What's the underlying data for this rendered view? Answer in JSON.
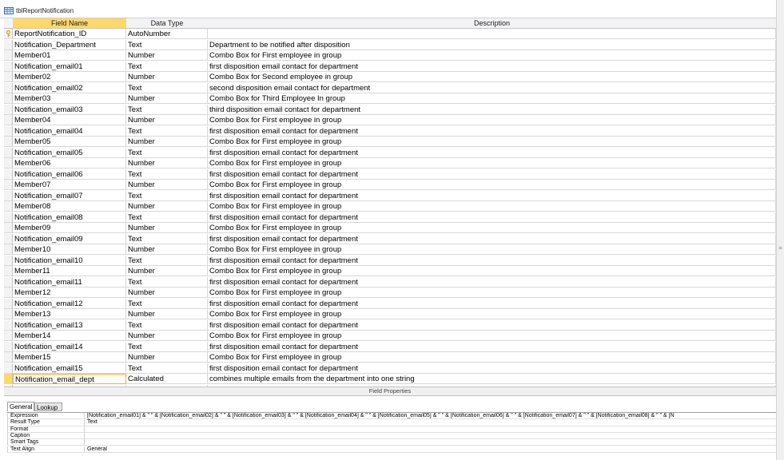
{
  "window": {
    "tab_title": "tblReportNotification"
  },
  "columns": [
    "Field Name",
    "Data Type",
    "Description"
  ],
  "rows": [
    {
      "field": "ReportNotification_ID",
      "type": "AutoNumber",
      "desc": "",
      "primary_key": true
    },
    {
      "field": "Notification_Department",
      "type": "Text",
      "desc": "Department to be notified after disposition"
    },
    {
      "field": "Member01",
      "type": "Number",
      "desc": "Combo Box for First employee in group"
    },
    {
      "field": "Notification_email01",
      "type": "Text",
      "desc": "first disposition email contact for department"
    },
    {
      "field": "Member02",
      "type": "Number",
      "desc": "Combo Box for Second employee in group"
    },
    {
      "field": "Notification_email02",
      "type": "Text",
      "desc": "second disposition email contact for department"
    },
    {
      "field": "Member03",
      "type": "Number",
      "desc": "Combo Box for Third Employee In group"
    },
    {
      "field": "Notification_email03",
      "type": "Text",
      "desc": "third disposition email contact for department"
    },
    {
      "field": "Member04",
      "type": "Number",
      "desc": "Combo Box for First employee in group"
    },
    {
      "field": "Notification_email04",
      "type": "Text",
      "desc": "first disposition email contact for department"
    },
    {
      "field": "Member05",
      "type": "Number",
      "desc": "Combo Box for First employee in group"
    },
    {
      "field": "Notification_email05",
      "type": "Text",
      "desc": "first disposition email contact for department"
    },
    {
      "field": "Member06",
      "type": "Number",
      "desc": "Combo Box for First employee in group"
    },
    {
      "field": "Notification_email06",
      "type": "Text",
      "desc": "first disposition email contact for department"
    },
    {
      "field": "Member07",
      "type": "Number",
      "desc": "Combo Box for First employee in group"
    },
    {
      "field": "Notification_email07",
      "type": "Text",
      "desc": "first disposition email contact for department"
    },
    {
      "field": "Member08",
      "type": "Number",
      "desc": "Combo Box for First employee in group"
    },
    {
      "field": "Notification_email08",
      "type": "Text",
      "desc": "first disposition email contact for department"
    },
    {
      "field": "Member09",
      "type": "Number",
      "desc": "Combo Box for First employee in group"
    },
    {
      "field": "Notification_email09",
      "type": "Text",
      "desc": "first disposition email contact for department"
    },
    {
      "field": "Member10",
      "type": "Number",
      "desc": "Combo Box for First employee in group"
    },
    {
      "field": "Notification_email10",
      "type": "Text",
      "desc": "first disposition email contact for department"
    },
    {
      "field": "Member11",
      "type": "Number",
      "desc": "Combo Box for First employee in group"
    },
    {
      "field": "Notification_email11",
      "type": "Text",
      "desc": "first disposition email contact for department"
    },
    {
      "field": "Member12",
      "type": "Number",
      "desc": "Combo Box for First employee in group"
    },
    {
      "field": "Notification_email12",
      "type": "Text",
      "desc": "first disposition email contact for department"
    },
    {
      "field": "Member13",
      "type": "Number",
      "desc": "Combo Box for First employee in group"
    },
    {
      "field": "Notification_email13",
      "type": "Text",
      "desc": "first disposition email contact for department"
    },
    {
      "field": "Member14",
      "type": "Number",
      "desc": "Combo Box for First employee in group"
    },
    {
      "field": "Notification_email14",
      "type": "Text",
      "desc": "first disposition email contact for department"
    },
    {
      "field": "Member15",
      "type": "Number",
      "desc": "Combo Box for First employee in group"
    },
    {
      "field": "Notification_email15",
      "type": "Text",
      "desc": "first disposition email contact for department"
    },
    {
      "field": "Notification_email_dept",
      "type": "Calculated",
      "desc": "combines multiple emails from the department into one string",
      "current": true
    }
  ],
  "field_properties": {
    "title": "Field Properties",
    "tabs": [
      "General",
      "Lookup"
    ],
    "items": [
      {
        "name": "Expression",
        "value": "[Notification_email01] & \" \" & [Notification_email02] & \" \" & [Notification_email03] & \" \" & [Notification_email04] & \" \" & [Notification_email05] & \" \" & [Notification_email06] & \" \" & [Notification_email07] & \" \" & [Notification_email08] & \" \" & [N"
      },
      {
        "name": "Result Type",
        "value": "Text"
      },
      {
        "name": "Format",
        "value": ""
      },
      {
        "name": "Caption",
        "value": ""
      },
      {
        "name": "Smart Tags",
        "value": ""
      },
      {
        "name": "Text Align",
        "value": "General"
      }
    ]
  },
  "colors": {
    "selected_header": "#ffd868",
    "key_icon": "#d4a017"
  },
  "icons": {
    "table": "table-icon",
    "primary_key": "key-icon"
  }
}
